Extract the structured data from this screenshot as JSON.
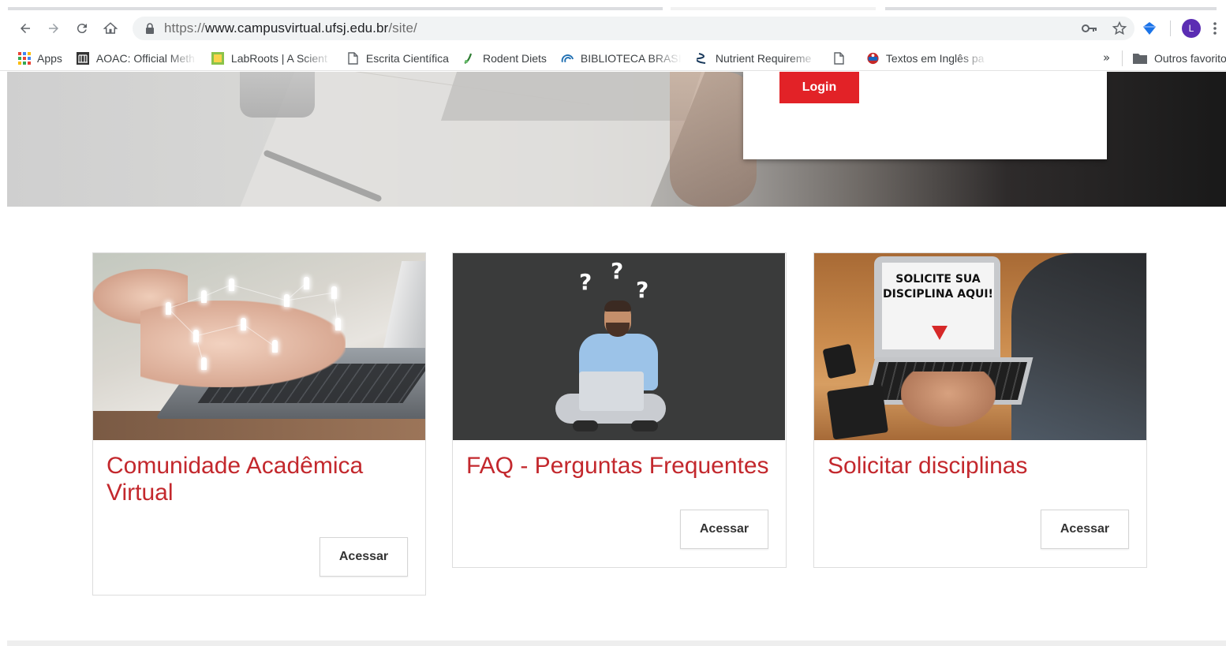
{
  "browser": {
    "url_scheme": "https://",
    "url_host": "www.campusvirtual.ufsj.edu.br",
    "url_path": "/site/",
    "profile_initial": "L",
    "bookmarks": [
      {
        "label": "Apps",
        "icon": "apps-grid-icon"
      },
      {
        "label": "AOAC: Official Meth",
        "icon": "aoac-icon"
      },
      {
        "label": "LabRoots | A Scient",
        "icon": "labroots-icon"
      },
      {
        "label": "Escrita Científica",
        "icon": "page-icon"
      },
      {
        "label": "Rodent Diets",
        "icon": "rodent-diets-icon"
      },
      {
        "label": "BIBLIOTECA BRASIL",
        "icon": "biblioteca-icon"
      },
      {
        "label": "Nutrient Requireme",
        "icon": "nutrient-icon"
      },
      {
        "label": "",
        "icon": "page-icon"
      },
      {
        "label": "Textos em Inglês pa",
        "icon": "textos-icon"
      }
    ],
    "bookmarks_more": "»",
    "other_bookmarks": "Outros favorito"
  },
  "hero": {
    "login_label": "Login"
  },
  "cards": [
    {
      "title": "Comunidade Acadêmica Virtual",
      "button": "Acessar"
    },
    {
      "title": "FAQ - Perguntas Frequentes",
      "button": "Acessar"
    },
    {
      "title": "Solicitar disciplinas",
      "button": "Acessar",
      "image_text": "SOLICITE SUA DISCIPLINA AQUI!"
    }
  ],
  "colors": {
    "accent_red": "#e22227",
    "title_red": "#c3282d",
    "profile_purple": "#5b2db3"
  }
}
